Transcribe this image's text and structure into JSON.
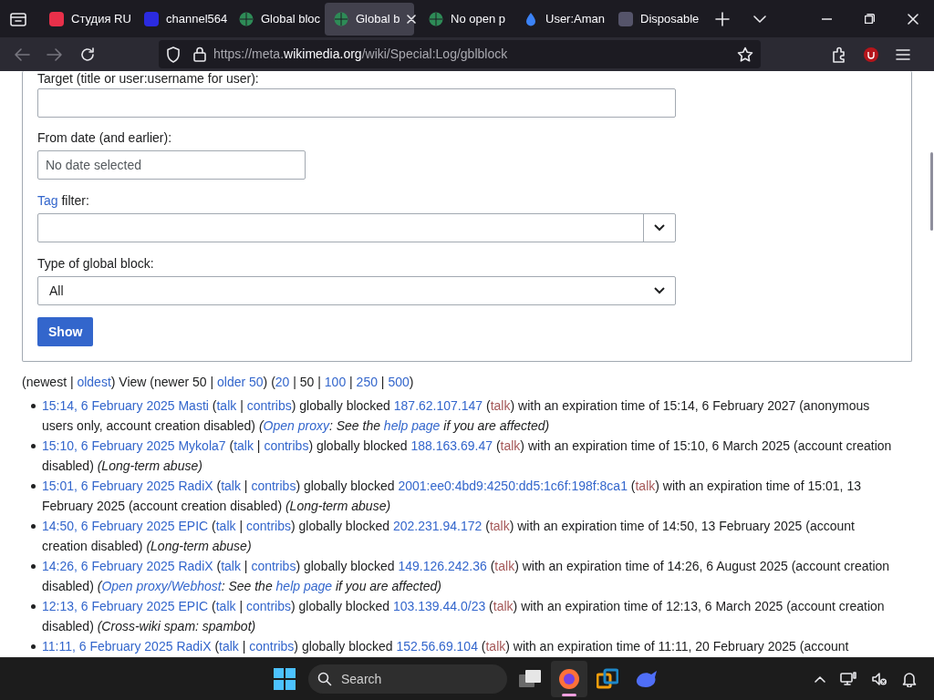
{
  "browser": {
    "tabs": [
      {
        "label": "Студия RU",
        "kind": "square",
        "color": "#e8304a",
        "selected": false
      },
      {
        "label": "channel564",
        "kind": "square",
        "color": "#2b2be0",
        "selected": false
      },
      {
        "label": "Global bloc",
        "kind": "globe",
        "color": "#2e8b57",
        "selected": false
      },
      {
        "label": "Global b",
        "kind": "globe",
        "color": "#2e8b57",
        "selected": true
      },
      {
        "label": "No open p",
        "kind": "globe",
        "color": "#2e8b57",
        "selected": false
      },
      {
        "label": "User:Aman",
        "kind": "drop",
        "color": "#3b82f6",
        "selected": false
      },
      {
        "label": "Disposable",
        "kind": "square",
        "color": "#55546a",
        "selected": false
      }
    ],
    "url": {
      "prefix": "https://meta.",
      "domain": "wikimedia.org",
      "path": "/wiki/Special:Log/gblblock"
    }
  },
  "form": {
    "target_label": "Target (title or user:username for user):",
    "date_label": "From date (and earlier):",
    "date_placeholder": "No date selected",
    "tag_label": [
      {
        "kind": "link",
        "text": "Tag"
      },
      {
        "kind": "text",
        "text": " filter:"
      }
    ],
    "type_label": "Type of global block:",
    "type_value": "All",
    "submit": "Show"
  },
  "pager": [
    {
      "kind": "text",
      "text": "(newest | "
    },
    {
      "kind": "link",
      "text": "oldest"
    },
    {
      "kind": "text",
      "text": ") View (newer 50 | "
    },
    {
      "kind": "link",
      "text": "older 50"
    },
    {
      "kind": "text",
      "text": ") ("
    },
    {
      "kind": "link",
      "text": "20"
    },
    {
      "kind": "text",
      "text": " | 50 | "
    },
    {
      "kind": "link",
      "text": "100"
    },
    {
      "kind": "text",
      "text": " | "
    },
    {
      "kind": "link",
      "text": "250"
    },
    {
      "kind": "text",
      "text": " | "
    },
    {
      "kind": "link",
      "text": "500"
    },
    {
      "kind": "text",
      "text": ")"
    }
  ],
  "entries": [
    [
      {
        "kind": "link",
        "text": "15:14, 6 February 2025"
      },
      {
        "kind": "gap"
      },
      {
        "kind": "link",
        "text": "Masti"
      },
      {
        "kind": "text",
        "text": " ("
      },
      {
        "kind": "link",
        "text": "talk"
      },
      {
        "kind": "text",
        "text": " | "
      },
      {
        "kind": "link",
        "text": "contribs"
      },
      {
        "kind": "text",
        "text": ") globally blocked "
      },
      {
        "kind": "link",
        "text": "187.62.107.147"
      },
      {
        "kind": "text",
        "text": " ("
      },
      {
        "kind": "redlink",
        "text": "talk"
      },
      {
        "kind": "text",
        "text": ") with an expiration time of 15:14, 6 February 2027 (anonymous users only, account creation disabled) "
      },
      {
        "kind": "em",
        "text": "("
      },
      {
        "kind": "emlink",
        "text": "Open proxy"
      },
      {
        "kind": "em",
        "text": ": See the "
      },
      {
        "kind": "emlink",
        "text": "help page"
      },
      {
        "kind": "em",
        "text": " if you are affected)"
      }
    ],
    [
      {
        "kind": "link",
        "text": "15:10, 6 February 2025"
      },
      {
        "kind": "gap"
      },
      {
        "kind": "link",
        "text": "Mykola7"
      },
      {
        "kind": "text",
        "text": " ("
      },
      {
        "kind": "link",
        "text": "talk"
      },
      {
        "kind": "text",
        "text": " | "
      },
      {
        "kind": "link",
        "text": "contribs"
      },
      {
        "kind": "text",
        "text": ") globally blocked "
      },
      {
        "kind": "link",
        "text": "188.163.69.47"
      },
      {
        "kind": "text",
        "text": " ("
      },
      {
        "kind": "redlink",
        "text": "talk"
      },
      {
        "kind": "text",
        "text": ") with an expiration time of 15:10, 6 March 2025 (account creation disabled) "
      },
      {
        "kind": "em",
        "text": "(Long-term abuse)"
      }
    ],
    [
      {
        "kind": "link",
        "text": "15:01, 6 February 2025"
      },
      {
        "kind": "gap"
      },
      {
        "kind": "link",
        "text": "RadiX"
      },
      {
        "kind": "text",
        "text": " ("
      },
      {
        "kind": "link",
        "text": "talk"
      },
      {
        "kind": "text",
        "text": " | "
      },
      {
        "kind": "link",
        "text": "contribs"
      },
      {
        "kind": "text",
        "text": ") globally blocked "
      },
      {
        "kind": "link",
        "text": "2001:ee0:4bd9:4250:dd5:1c6f:198f:8ca1"
      },
      {
        "kind": "text",
        "text": " ("
      },
      {
        "kind": "redlink",
        "text": "talk"
      },
      {
        "kind": "text",
        "text": ") with an expiration time of 15:01, 13 February 2025 (account creation disabled) "
      },
      {
        "kind": "em",
        "text": "(Long-term abuse)"
      }
    ],
    [
      {
        "kind": "link",
        "text": "14:50, 6 February 2025"
      },
      {
        "kind": "gap"
      },
      {
        "kind": "link",
        "text": "EPIC"
      },
      {
        "kind": "text",
        "text": " ("
      },
      {
        "kind": "link",
        "text": "talk"
      },
      {
        "kind": "text",
        "text": " | "
      },
      {
        "kind": "link",
        "text": "contribs"
      },
      {
        "kind": "text",
        "text": ") globally blocked "
      },
      {
        "kind": "link",
        "text": "202.231.94.172"
      },
      {
        "kind": "text",
        "text": " ("
      },
      {
        "kind": "redlink",
        "text": "talk"
      },
      {
        "kind": "text",
        "text": ") with an expiration time of 14:50, 13 February 2025 (account creation disabled) "
      },
      {
        "kind": "em",
        "text": "(Long-term abuse)"
      }
    ],
    [
      {
        "kind": "link",
        "text": "14:26, 6 February 2025"
      },
      {
        "kind": "gap"
      },
      {
        "kind": "link",
        "text": "RadiX"
      },
      {
        "kind": "text",
        "text": " ("
      },
      {
        "kind": "link",
        "text": "talk"
      },
      {
        "kind": "text",
        "text": " | "
      },
      {
        "kind": "link",
        "text": "contribs"
      },
      {
        "kind": "text",
        "text": ") globally blocked "
      },
      {
        "kind": "link",
        "text": "149.126.242.36"
      },
      {
        "kind": "text",
        "text": " ("
      },
      {
        "kind": "redlink",
        "text": "talk"
      },
      {
        "kind": "text",
        "text": ") with an expiration time of 14:26, 6 August 2025 (account creation disabled) "
      },
      {
        "kind": "em",
        "text": "("
      },
      {
        "kind": "emlink",
        "text": "Open proxy/Webhost"
      },
      {
        "kind": "em",
        "text": ": See the "
      },
      {
        "kind": "emlink",
        "text": "help page"
      },
      {
        "kind": "em",
        "text": " if you are affected)"
      }
    ],
    [
      {
        "kind": "link",
        "text": "12:13, 6 February 2025"
      },
      {
        "kind": "gap"
      },
      {
        "kind": "link",
        "text": "EPIC"
      },
      {
        "kind": "text",
        "text": " ("
      },
      {
        "kind": "link",
        "text": "talk"
      },
      {
        "kind": "text",
        "text": " | "
      },
      {
        "kind": "link",
        "text": "contribs"
      },
      {
        "kind": "text",
        "text": ") globally blocked "
      },
      {
        "kind": "link",
        "text": "103.139.44.0/23"
      },
      {
        "kind": "text",
        "text": " ("
      },
      {
        "kind": "redlink",
        "text": "talk"
      },
      {
        "kind": "text",
        "text": ") with an expiration time of 12:13, 6 March 2025 (account creation disabled) "
      },
      {
        "kind": "em",
        "text": "(Cross-wiki spam: spambot)"
      }
    ],
    [
      {
        "kind": "link",
        "text": "11:11, 6 February 2025"
      },
      {
        "kind": "gap"
      },
      {
        "kind": "link",
        "text": "RadiX"
      },
      {
        "kind": "text",
        "text": " ("
      },
      {
        "kind": "link",
        "text": "talk"
      },
      {
        "kind": "text",
        "text": " | "
      },
      {
        "kind": "link",
        "text": "contribs"
      },
      {
        "kind": "text",
        "text": ") globally blocked "
      },
      {
        "kind": "link",
        "text": "152.56.69.104"
      },
      {
        "kind": "text",
        "text": " ("
      },
      {
        "kind": "redlink",
        "text": "talk"
      },
      {
        "kind": "text",
        "text": ") with an expiration time of 11:11, 20 February 2025 (account"
      }
    ]
  ],
  "taskbar": {
    "search_placeholder": "Search"
  }
}
